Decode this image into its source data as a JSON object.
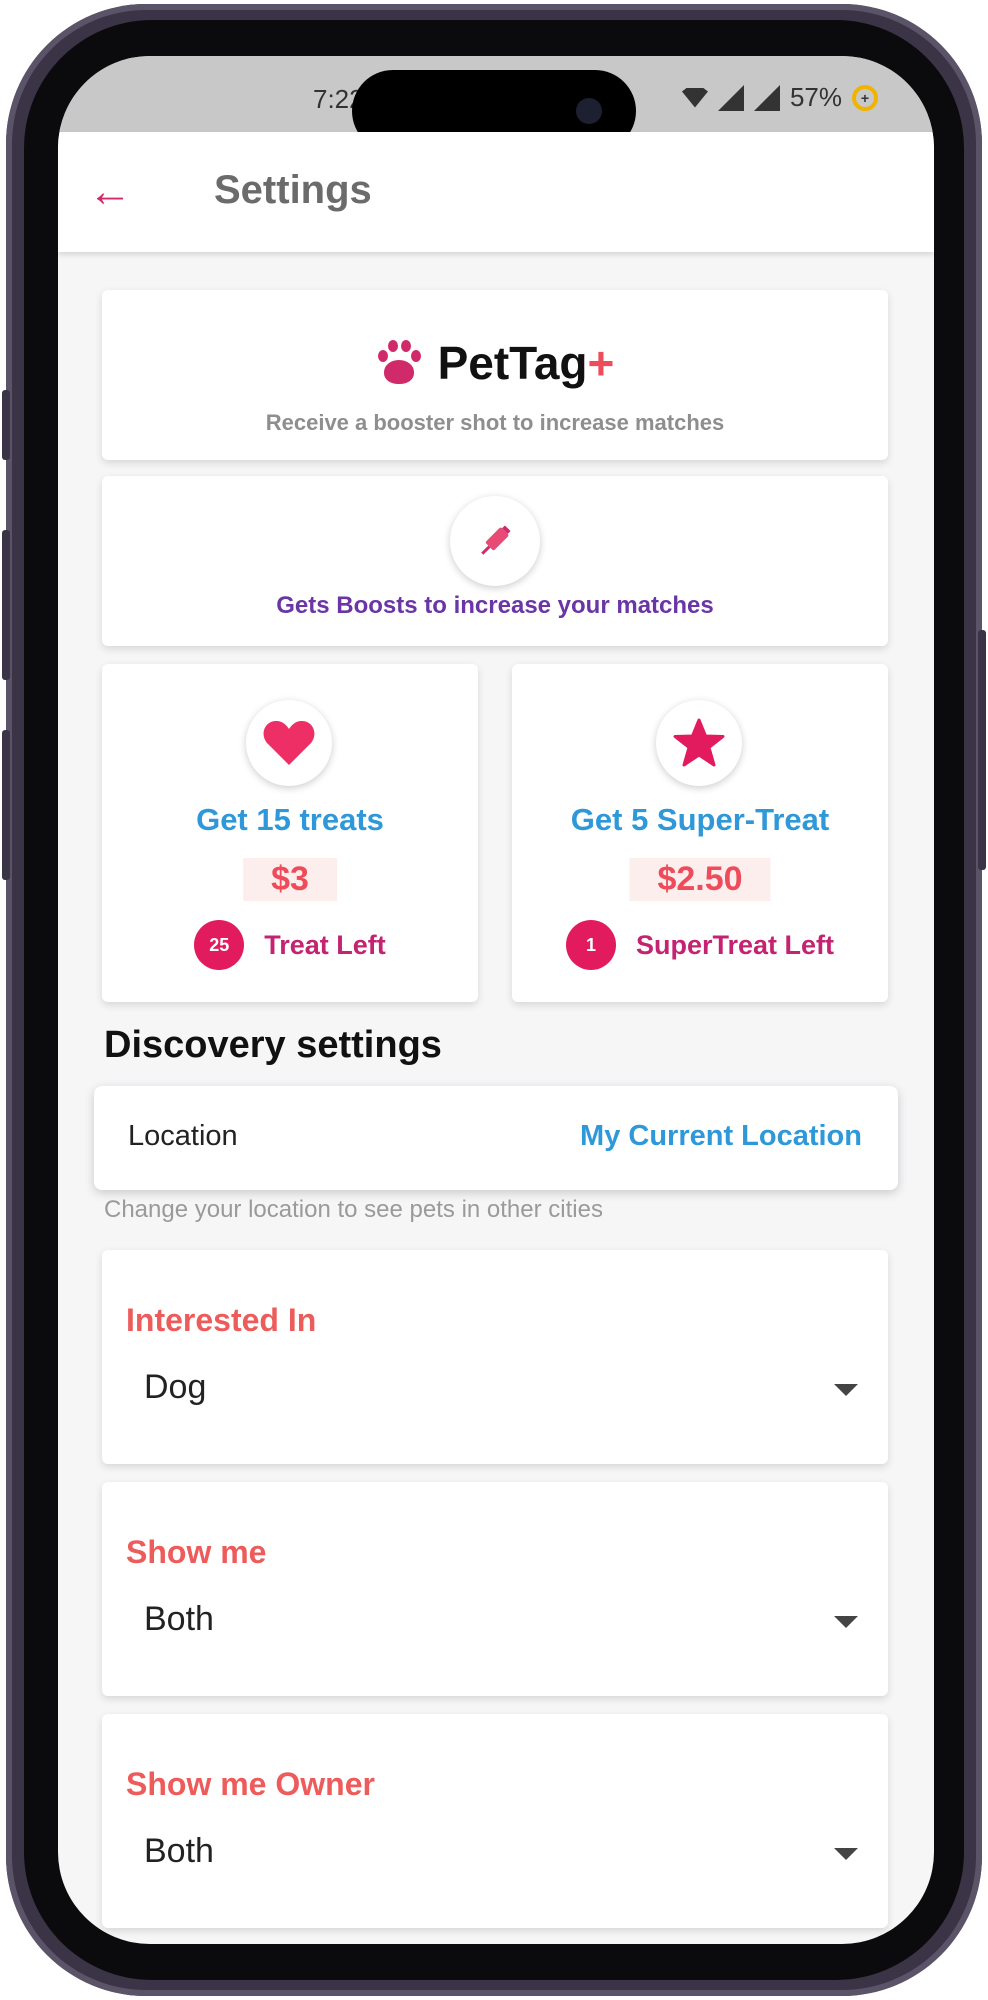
{
  "status_bar": {
    "time": "7:22",
    "battery": "57%",
    "battery_glyph": "+"
  },
  "app_bar": {
    "back_icon": "arrow-left-icon",
    "title": "Settings"
  },
  "brand_card": {
    "name": "PetTag",
    "plus": "+",
    "subtitle": "Receive a booster shot to increase matches"
  },
  "boost_card": {
    "icon": "syringe-icon",
    "text": "Gets Boosts to increase your matches"
  },
  "treat_cards": [
    {
      "icon": "heart-icon",
      "title": "Get 15 treats",
      "price": "$3",
      "count": "25",
      "count_label": "Treat Left"
    },
    {
      "icon": "star-icon",
      "title": "Get 5 Super-Treat",
      "price": "$2.50",
      "count": "1",
      "count_label": "SuperTreat Left"
    }
  ],
  "discovery": {
    "section_title": "Discovery settings",
    "location_label": "Location",
    "location_value": "My Current Location",
    "location_hint": "Change your location to see pets in other cities",
    "dropdowns": [
      {
        "label": "Interested In",
        "value": "Dog"
      },
      {
        "label": "Show me",
        "value": "Both"
      },
      {
        "label": "Show me Owner",
        "value": "Both"
      }
    ]
  },
  "colors": {
    "accent_pink": "#e21b5e",
    "link_blue": "#2e98d8",
    "label_red": "#ee5b5b",
    "purple": "#6a35a5"
  }
}
